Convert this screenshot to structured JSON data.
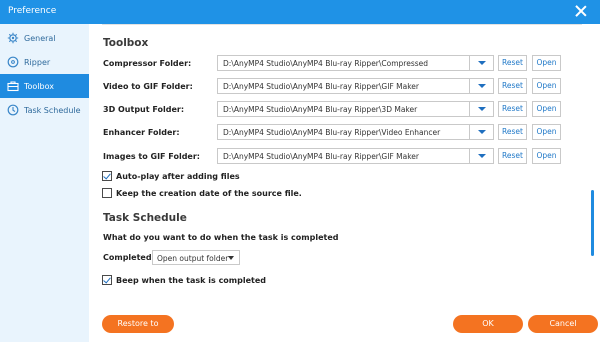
{
  "window": {
    "title": "Preference"
  },
  "sidebar": {
    "items": [
      {
        "label": "General",
        "icon": "gear-icon"
      },
      {
        "label": "Ripper",
        "icon": "disc-icon"
      },
      {
        "label": "Toolbox",
        "icon": "toolbox-icon",
        "active": true
      },
      {
        "label": "Task Schedule",
        "icon": "clock-icon"
      }
    ]
  },
  "toolbox": {
    "title": "Toolbox",
    "folders": [
      {
        "label": "Compressor Folder:",
        "path": "D:\\AnyMP4 Studio\\AnyMP4 Blu-ray Ripper\\Compressed"
      },
      {
        "label": "Video to GIF Folder:",
        "path": "D:\\AnyMP4 Studio\\AnyMP4 Blu-ray Ripper\\GIF Maker"
      },
      {
        "label": "3D Output Folder:",
        "path": "D:\\AnyMP4 Studio\\AnyMP4 Blu-ray Ripper\\3D Maker"
      },
      {
        "label": "Enhancer Folder:",
        "path": "D:\\AnyMP4 Studio\\AnyMP4 Blu-ray Ripper\\Video Enhancer"
      },
      {
        "label": "Images to GIF Folder:",
        "path": "D:\\AnyMP4 Studio\\AnyMP4 Blu-ray Ripper\\GIF Maker"
      }
    ],
    "reset_label": "Reset",
    "open_label": "Open",
    "autoplay": {
      "label": "Auto-play after adding files",
      "checked": true
    },
    "keep_date": {
      "label": "Keep the creation date of the source file.",
      "checked": false
    }
  },
  "task_schedule": {
    "title": "Task Schedule",
    "question": "What do you want to do when the task is completed",
    "completed_label": "Completed:",
    "completed_value": "Open output folder",
    "beep": {
      "label": "Beep when the task is completed",
      "checked": true
    }
  },
  "footer": {
    "restore_label": "Restore to Default",
    "ok_label": "OK",
    "cancel_label": "Cancel"
  },
  "colors": {
    "accent": "#1f8be0",
    "title_bar": "#1f92e6",
    "action": "#f47321",
    "sidebar_bg": "#e9f4fd"
  }
}
